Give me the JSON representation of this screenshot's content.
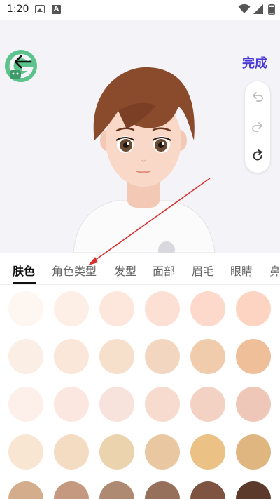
{
  "status_bar": {
    "time": "1:20"
  },
  "header": {
    "done_label": "完成"
  },
  "tabs": [
    {
      "label": "肤色",
      "active": true
    },
    {
      "label": "角色类型",
      "active": false
    },
    {
      "label": "发型",
      "active": false
    },
    {
      "label": "面部",
      "active": false
    },
    {
      "label": "眉毛",
      "active": false
    },
    {
      "label": "眼睛",
      "active": false
    },
    {
      "label": "鼻",
      "active": false
    }
  ],
  "colors": {
    "accent": "#4b3bd6",
    "logo_green": "#5cc38c",
    "annotation": "#d9302f"
  },
  "skin_swatches": [
    [
      "#fdf6f1",
      "#fdeee6",
      "#fde6dc",
      "#fde0d4",
      "#fdd9cb",
      "#fdd4c2"
    ],
    [
      "#fbeee4",
      "#fae7d9",
      "#f6e0cb",
      "#f3d6bf",
      "#f0ccad",
      "#eebf99"
    ],
    [
      "#fdefea",
      "#fbe7df",
      "#f8e2dc",
      "#f7dbcf",
      "#f3d2c4",
      "#efc7b8"
    ],
    [
      "#f8e6d2",
      "#f3dcc2",
      "#ebd3ad",
      "#e8c7a1",
      "#ebc186",
      "#dfb580"
    ],
    [
      "#d4ad8c",
      "#c59880",
      "#ae8a73",
      "#97705c",
      "#7e5341",
      "#5b3a2c"
    ]
  ]
}
